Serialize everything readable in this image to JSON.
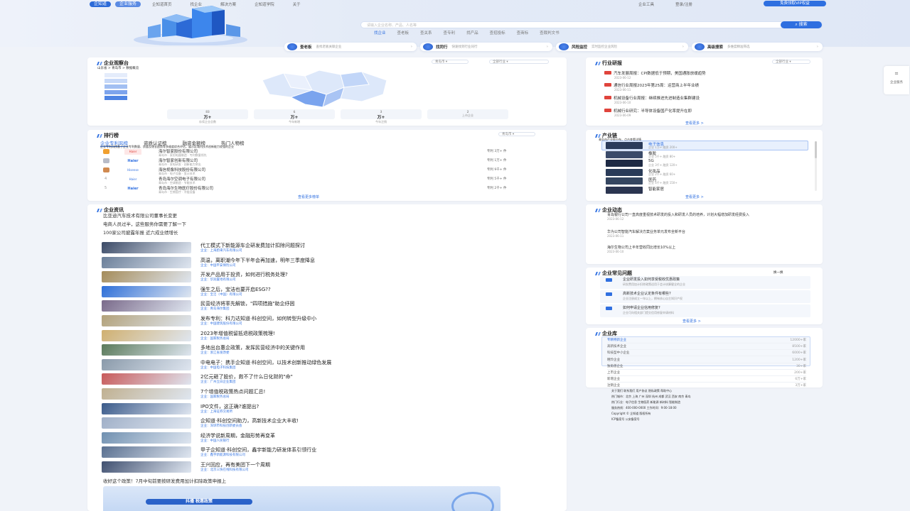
{
  "nav": {
    "brand": "企知道",
    "badge": "企业服务",
    "items": [
      "企知道首页",
      "找企业",
      "解决方案",
      "企知道学院",
      "关于"
    ],
    "right": [
      "企业工具",
      "登录/注册"
    ],
    "register": "免费领取VIP权益"
  },
  "search": {
    "placeholder": "请输入企业名称、产品、人名等",
    "button": "搜索",
    "tabs": [
      "找企业",
      "查老板",
      "查关系",
      "查专利",
      "找产品",
      "查招投标",
      "查商标",
      "查裁判文书"
    ]
  },
  "quick": [
    {
      "title": "查老板",
      "sub": "查找老板关联企业"
    },
    {
      "title": "找同行",
      "sub": "快速找到行业同行"
    },
    {
      "title": "风险监控",
      "sub": "实时监控企业风险"
    },
    {
      "title": "高级搜索",
      "sub": "多维度精准筛选"
    }
  ],
  "overview": {
    "title": "企业观察台",
    "filter1": "青岛市",
    "filter2": "全部行业",
    "subtitle": "山东省 > 青岛市 > 数据概览",
    "stats": [
      {
        "value": "83",
        "unit": "万+",
        "label": "存续企业总数"
      },
      {
        "value": "6",
        "unit": "万+",
        "label": "今年新增"
      },
      {
        "value": "3",
        "unit": "万+",
        "label": "今年注销"
      },
      {
        "value": "2",
        "unit": "",
        "label": "上市企业"
      }
    ]
  },
  "ranking": {
    "title": "排行榜",
    "filter": "青岛市",
    "tabs": [
      "企业专利风榜",
      "资质认证榜",
      "融资金额榜",
      "热门人物榜"
    ],
    "desc": "企业专利风榜基于企业专利数量、质量及增长趋势等多维度综合评估，展示区域内技术创新能力较强的企业",
    "items": [
      {
        "name": "海尔智家股份有限公司",
        "sub": "青岛市 · 家用电器制造 · 专利数量领先",
        "score": "专利 3万+ 件"
      },
      {
        "name": "海尔智家创新有限公司",
        "sub": "青岛市 · 家电研发 · 创新能力突出",
        "score": "专利 1万+ 件"
      },
      {
        "name": "海信视像科技股份有限公司",
        "sub": "青岛市 · 电子设备 · 显示技术",
        "score": "专利 9千+ 件"
      },
      {
        "name": "青岛海尔空调电子有限公司",
        "sub": "青岛市 · 空调制造 · 节能技术",
        "score": "专利 5千+ 件"
      },
      {
        "name": "青岛海尔生物医疗股份有限公司",
        "sub": "青岛市 · 生物医疗 · 冷链设备",
        "score": "专利 2千+ 件"
      }
    ],
    "more": "查看更多榜单"
  },
  "news": {
    "title": "企业资讯",
    "top": [
      "比亚迪汽车技术有限公司董事长变更",
      "电商人员过半，这些服务你需要了解一下",
      "100家公司披露年报 近六成业绩增长"
    ],
    "items": [
      {
        "title": "代工模式下新能源车企研发费加计扣除问题探讨",
        "sub": "企业：上海蔚来汽车有限公司"
      },
      {
        "title": "高温，离职潮今年下半年会再加速，明年三季度降息",
        "sub": "企业：中国平安保险公司"
      },
      {
        "title": "开发产品用于投资，如何进行税务处理?",
        "sub": "企业：华润置地有限公司"
      },
      {
        "title": "强生之后，宝洁也要开启ESG??",
        "sub": "企业：宝洁（中国）有限公司"
      },
      {
        "title": "民营经济将率先解锁，\"四项措施\"助企纾困",
        "sub": "企业：青岛海尔集团"
      },
      {
        "title": "发布专利：科力达知道·科创空间，如何转型升级中小",
        "sub": "企业：中国建筑股份有限公司"
      },
      {
        "title": "2023年增值税留抵退税政策梳理!",
        "sub": "企业：国家税务总局"
      },
      {
        "title": "多地出台惠企政策，发挥民营经济中的关键作用",
        "sub": "企业：浙江省发改委"
      },
      {
        "title": "中电电子：携手企知道·科创空间，以技术创新推动绿色发展",
        "sub": "企业：中国电子科技集团"
      },
      {
        "title": "2亿元砸了股价，救不了什么日化财的\"命\"",
        "sub": "企业：广州立白企业集团"
      },
      {
        "title": "7个增值税政策热点问题汇总!",
        "sub": "企业：国家税务总局"
      },
      {
        "title": "IPO文件，这正确?谁提出?",
        "sub": "企业：上海证券交易所"
      },
      {
        "title": "企知道·科创空间助力，高新技术企业大丰收!",
        "sub": "企业：深圳市科技创新委员会"
      },
      {
        "title": "经济学说新周期，金融形势再变革",
        "sub": "企业：中国人民银行"
      },
      {
        "title": "甲子企知道·科创空间，鑫宇新能力研发体系引领行业",
        "sub": "企业：鑫宇新能源科技有限公司"
      },
      {
        "title": "王兴回应，再有美团下一个周期",
        "sub": "企业：北京三快在线科技有限公司"
      }
    ],
    "bottom": "收好这个政策！7月中旬前要按研发费用加计扣除政策申报上",
    "banner": "抖播 税惠政策"
  },
  "industryNews": {
    "title": "行业研报",
    "filter": "全部行业",
    "items": [
      {
        "title": "汽车发展周报：CPI数据低于预期，美国通胀放缓趋势",
        "date": "2023-06-12"
      },
      {
        "title": "通信行业周报2023年第25周：运营商上半年业绩",
        "date": "2023-06-11"
      },
      {
        "title": "机械设备行业周报：继续推进先进制造业集群建设",
        "date": "2023-06-10"
      },
      {
        "title": "机械行业研究：半导体设备国产化率提升在即",
        "date": "2023-06-09"
      }
    ],
    "more": "查看更多 >"
  },
  "chain": {
    "title": "产业链",
    "desc": "青岛市产业链分布，点击查看详情",
    "items": [
      {
        "name": "电子信息",
        "info": "企业 1万+  融资 200+"
      },
      {
        "name": "橡胶",
        "info": "企业 5千+  融资 80+"
      },
      {
        "name": "5G",
        "info": "企业 3千+  融资 120+"
      },
      {
        "name": "化妆品",
        "info": "企业 2千+  融资 60+"
      },
      {
        "name": "医药",
        "info": "企业 4千+  融资 150+"
      },
      {
        "name": "智能家居",
        "info": ""
      }
    ],
    "more": "查看更多 >"
  },
  "dynamics": {
    "title": "企业动态",
    "items": [
      {
        "text": "青岛银行公司一直高度重视技术研发的投入和研发人员的培养，计划大幅增加研发经费投入",
        "date": "2023-06-12"
      },
      {
        "text": "华为公司智能汽车解决方案业务单元发布全新平台",
        "date": "2023-06-11"
      },
      {
        "text": "海尔生物公司上半年营收同比增长10%以上",
        "date": "2023-06-10"
      }
    ]
  },
  "faq": {
    "title": "企业常见问题",
    "filter": "换一换",
    "items": [
      {
        "q": "企业研发投入如何享受税收优惠政策",
        "a": "研发费用加计扣除政策适用于会计核算健全的企业"
      },
      {
        "q": "高新技术企业认定条件有哪些?",
        "a": "企业注册成立一年以上，拥有核心自主知识产权"
      },
      {
        "q": "如何申请企业信用修复?",
        "a": "企业可向相关部门提交信用修复申请材料"
      }
    ],
    "more": "查看更多 >"
  },
  "library": {
    "title": "企业库",
    "rows": [
      {
        "name": "专精特新企业",
        "count": "12000+家"
      },
      {
        "name": "高新技术企业",
        "count": "8500+家"
      },
      {
        "name": "科技型中小企业",
        "count": "6000+家"
      },
      {
        "name": "瞪羚企业",
        "count": "1200+家"
      },
      {
        "name": "独角兽企业",
        "count": "30+家"
      },
      {
        "name": "上市企业",
        "count": "200+家"
      },
      {
        "name": "新增企业",
        "count": "6万+家"
      },
      {
        "name": "注销企业",
        "count": "3万+家"
      }
    ]
  },
  "footer": {
    "lines": [
      "关于我们  联系我们  用户协议  隐私政策  帮助中心",
      "热门城市：北京 上海 广州 深圳 杭州 成都 武汉 西安 南京 青岛",
      "热门行业：电子信息 生物医药 新能源 新材料 智能制造",
      "服务热线：400-000-0000  工作时间：9:00-18:00",
      "Copyright © 企知道 版权所有",
      "ICP备案号  公安备案号"
    ]
  },
  "sidebar": {
    "label": "企业服务"
  },
  "colors": {
    "accent": "#2f6fe0",
    "danger": "#e0443c",
    "bg": "#f0f3f9"
  }
}
